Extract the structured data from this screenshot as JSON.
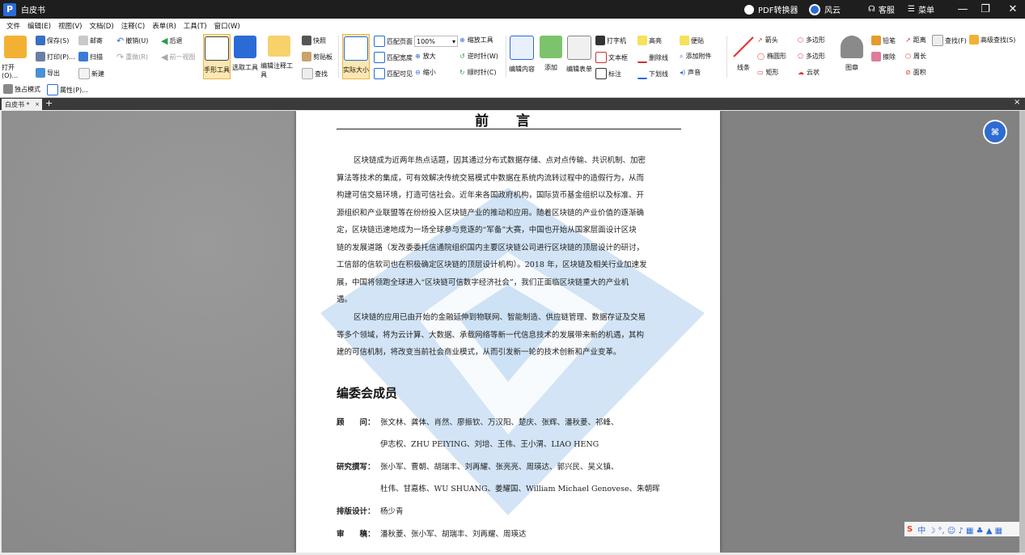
{
  "app": {
    "title": "白皮书",
    "pdf_converter": "PDF转换器",
    "fengyun": "风云",
    "support": "客服",
    "menu": "菜单"
  },
  "menubar": [
    "文件",
    "编辑(E)",
    "视图(V)",
    "文档(D)",
    "注释(C)",
    "表单(R)",
    "工具(T)",
    "窗口(W)"
  ],
  "ribbon": {
    "open": "打开(O)...",
    "save": "保存(S)",
    "print": "打印(P)...",
    "export": "导出",
    "mail": "邮寄",
    "scan": "扫描",
    "new": "新建",
    "undo": "撤销(U)",
    "redo": "重做(R)",
    "back": "后退",
    "prev_view": "前一视图",
    "hand_tool": "手形工具",
    "select_tool": "选取工具",
    "edit_annot_tool": "编辑注释工具",
    "snapshot": "快照",
    "clipboard": "剪贴板",
    "find": "查找",
    "actual_size": "实际大小",
    "fit_page": "匹配页面",
    "fit_width": "匹配宽度",
    "fit_visible": "匹配可见",
    "zoom_value": "100%",
    "zoom_tool": "缩放工具",
    "zoom_in": "放大",
    "zoom_out": "缩小",
    "rotate_ccw": "逆时针(W)",
    "rotate_cw": "顺时针(C)",
    "edit_content": "编辑内容",
    "add": "添加",
    "edit_form": "编辑表单",
    "typewriter": "打字机",
    "textbox": "文本框",
    "callout": "标注",
    "highlight": "高亮",
    "strikeout": "删除线",
    "underline": "下划线",
    "note": "便贴",
    "attach": "添加附件",
    "sound": "声音",
    "line": "线条",
    "arrow": "箭头",
    "ellipse": "椭圆形",
    "rect": "矩形",
    "polyline": "多边形",
    "polygon": "多边形",
    "cloud": "云状",
    "stamp": "图章",
    "pencil": "铅笔",
    "eraser": "擦除",
    "distance": "距离",
    "perimeter": "周长",
    "area": "面积",
    "search": "查找(F)",
    "advanced_search": "高级查找(S)"
  },
  "subbar": {
    "exclusive_mode": "独占模式",
    "properties": "属性(P)..."
  },
  "tab": {
    "label": "白皮书 *"
  },
  "document": {
    "title": "前 言",
    "paragraph1": [
      "区块链成为近两年热点话题，因其通过分布式数据存储、点对点传输、共识机制、加密",
      "算法等技术的集成，可有效解决传统交易模式中数据在系统内流转过程中的造假行为，从而",
      "构建可信交易环境，打造可信社会。近年来各国政府机构，国际货币基金组织以及标准、开",
      "源组织和产业联盟等在纷纷投入区块链产业的推动和应用。随着区块链的产业价值的逐渐确",
      "定，区块链迅速地成为一场全球参与竞逐的“军备”大赛，中国也开始从国家层面设计区块",
      "链的发展道路（发改委委托信通院组织国内主要区块链公司进行区块链的顶层设计的研讨，",
      "工信部的信软司也在积极确定区块链的顶层设计机构）。2018 年，区块链及相关行业加速发",
      "展，中国将领跑全球进入“区块链可信数字经济社会”，我们正面临区块链重大的产业机",
      "遇。"
    ],
    "paragraph2": [
      "区块链的应用已由开始的金融延伸到物联网、智能制造、供应链管理、数据存证及交易",
      "等多个领域，将为云计算、大数据、承载网络等新一代信息技术的发展带来新的机遇，其构",
      "建的可信机制，将改变当前社会商业模式，从而引发新一轮的技术创新和产业变革。"
    ],
    "section_heading": "编委会成员",
    "members": [
      {
        "label": "顾　　问：",
        "line1": "张文林、龚体、肖然、廖振钦、万汉阳、楚庆、张辉、潘秋菱、祁峰、",
        "line2": "伊志权、ZHU PEIYING、刘培、王伟、王小渭、LIAO HENG"
      },
      {
        "label": "研究撰写：",
        "line1": "张小军、曹朝、胡瑞丰、刘再耀、张亮亮、周瑛达、郭兴民、吴义镇、",
        "line2": "杜伟、甘嘉栋、WU SHUANG、姜耀国、William Michael Genovese、朱朝晖"
      },
      {
        "label": "排版设计：",
        "line1": "杨少青",
        "line2": ""
      },
      {
        "label": "审　　稿：",
        "line1": "潘秋菱、张小军、胡瑞丰、刘再耀、周瑛达",
        "line2": ""
      }
    ]
  },
  "colors": {
    "titlebar": "#1e1e1e",
    "accent": "#2b6bd6",
    "active_tool": "#fde7b0",
    "watermark": "#9cc3ec"
  }
}
